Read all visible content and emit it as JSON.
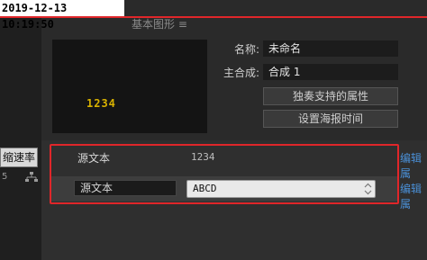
{
  "timestamp": "2019-12-13 10:19:50",
  "panel": {
    "heading": "基本图形 ≡"
  },
  "preview": {
    "text": "1234"
  },
  "properties": {
    "name_label": "名称:",
    "name_value": "未命名",
    "master_label": "主合成:",
    "master_value": "合成 1",
    "solo_button": "独奏支持的属性",
    "poster_button": "设置海报时间"
  },
  "left_panel": {
    "button_label": "缩速率",
    "value": "5"
  },
  "rows": [
    {
      "label": "源文本",
      "value": "1234",
      "edit": "编辑属"
    },
    {
      "label": "源文本",
      "value": "ABCD",
      "edit": "编辑属"
    }
  ],
  "colors": {
    "highlight": "#e0262a",
    "link": "#4a8fd6",
    "preview_text": "#d9b200"
  }
}
